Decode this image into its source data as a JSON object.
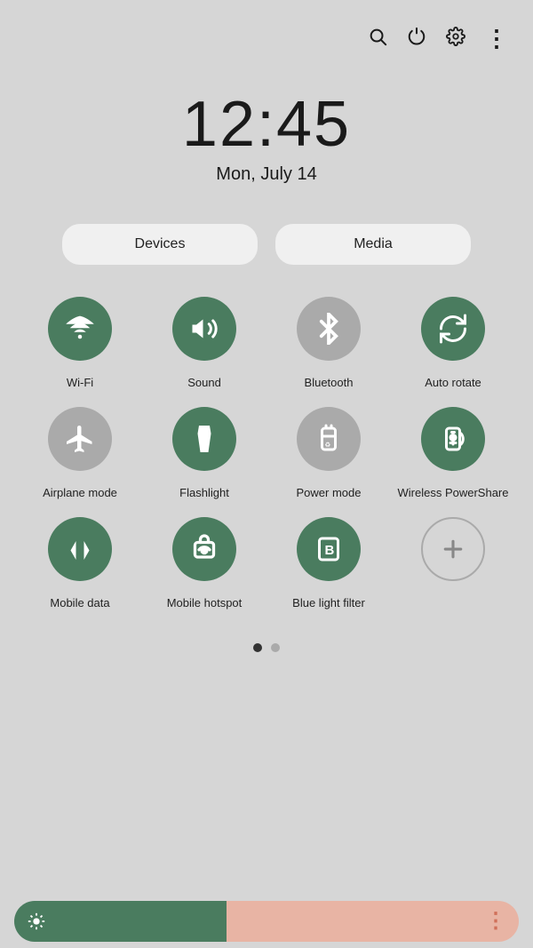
{
  "topIcons": {
    "search": "🔍",
    "power": "⏻",
    "settings": "⚙",
    "more": "⋮"
  },
  "clock": {
    "time": "12:45",
    "date": "Mon, July 14"
  },
  "quickButtons": {
    "devices": "Devices",
    "media": "Media"
  },
  "tiles": [
    {
      "id": "wifi",
      "label": "Wi-Fi",
      "active": true,
      "icon": "wifi"
    },
    {
      "id": "sound",
      "label": "Sound",
      "active": true,
      "icon": "sound"
    },
    {
      "id": "bluetooth",
      "label": "Bluetooth",
      "active": false,
      "icon": "bluetooth"
    },
    {
      "id": "autorotate",
      "label": "Auto rotate",
      "active": true,
      "icon": "autorotate"
    },
    {
      "id": "airplane",
      "label": "Airplane mode",
      "active": false,
      "icon": "airplane"
    },
    {
      "id": "flashlight",
      "label": "Flashlight",
      "active": true,
      "icon": "flashlight"
    },
    {
      "id": "powermode",
      "label": "Power mode",
      "active": false,
      "icon": "powermode"
    },
    {
      "id": "wireless",
      "label": "Wireless PowerShare",
      "active": true,
      "icon": "wireless"
    },
    {
      "id": "mobiledata",
      "label": "Mobile data",
      "active": true,
      "icon": "mobiledata"
    },
    {
      "id": "hotspot",
      "label": "Mobile hotspot",
      "active": true,
      "icon": "hotspot"
    },
    {
      "id": "bluelight",
      "label": "Blue light filter",
      "active": true,
      "icon": "bluelight"
    },
    {
      "id": "add",
      "label": "",
      "active": false,
      "icon": "add"
    }
  ],
  "pagination": {
    "activeDot": 0,
    "totalDots": 2
  },
  "brightness": {
    "sunIcon": "☀",
    "dotsIcon": "⋮",
    "fillPercent": 42
  }
}
